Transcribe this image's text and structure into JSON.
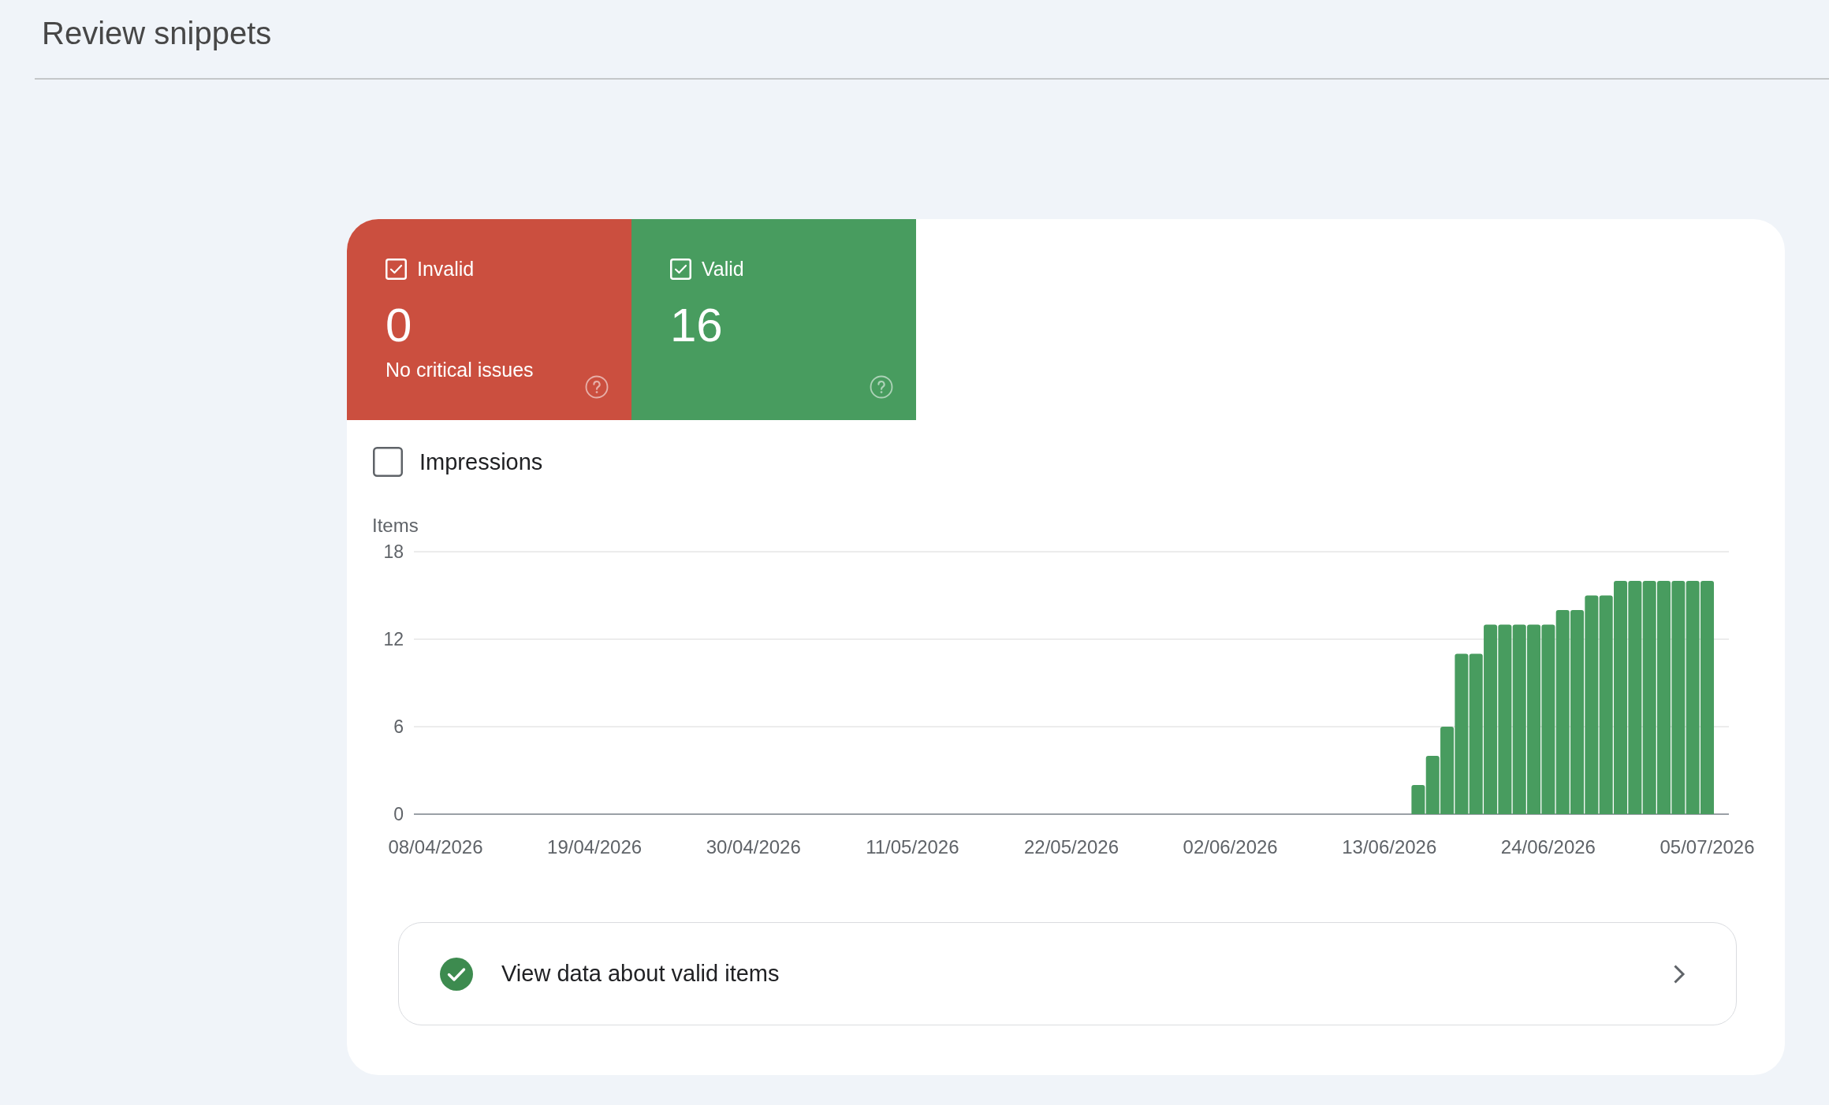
{
  "title": "Review snippets",
  "tiles": [
    {
      "label": "Invalid",
      "checked": true,
      "count": "0",
      "caption": "No critical issues",
      "color": "#cb4f3f"
    },
    {
      "label": "Valid",
      "checked": true,
      "count": "16",
      "color": "#489c5f"
    }
  ],
  "impressions": {
    "label": "Impressions",
    "checked": false
  },
  "chart": {
    "chart_data": {
      "type": "bar",
      "ylabel": "Items",
      "categories": [
        null,
        "08/04/2026",
        null,
        null,
        null,
        null,
        null,
        null,
        null,
        null,
        null,
        null,
        "19/04/2026",
        null,
        null,
        null,
        null,
        null,
        null,
        null,
        null,
        null,
        null,
        "30/04/2026",
        null,
        null,
        null,
        null,
        null,
        null,
        null,
        null,
        null,
        null,
        "11/05/2026",
        null,
        null,
        null,
        null,
        null,
        null,
        null,
        null,
        null,
        null,
        "22/05/2026",
        null,
        null,
        null,
        null,
        null,
        null,
        null,
        null,
        null,
        null,
        "02/06/2026",
        null,
        null,
        null,
        null,
        null,
        null,
        null,
        null,
        null,
        null,
        "13/06/2026",
        null,
        null,
        null,
        null,
        null,
        null,
        null,
        null,
        null,
        null,
        "24/06/2026",
        null,
        null,
        null,
        null,
        null,
        null,
        null,
        null,
        null,
        null,
        "05/07/2026",
        null
      ],
      "values": [
        null,
        null,
        null,
        null,
        null,
        null,
        null,
        null,
        null,
        null,
        null,
        null,
        null,
        null,
        null,
        null,
        null,
        null,
        null,
        null,
        null,
        null,
        null,
        null,
        null,
        null,
        null,
        null,
        null,
        null,
        null,
        null,
        null,
        null,
        null,
        null,
        null,
        null,
        null,
        null,
        null,
        null,
        null,
        null,
        null,
        null,
        null,
        null,
        null,
        null,
        null,
        null,
        null,
        null,
        null,
        null,
        null,
        null,
        null,
        null,
        null,
        null,
        null,
        null,
        null,
        null,
        null,
        null,
        null,
        2,
        4,
        6,
        11,
        11,
        13,
        13,
        13,
        13,
        13,
        14,
        14,
        15,
        15,
        16,
        16,
        16,
        16,
        16,
        16,
        16,
        null
      ],
      "ylim": [
        0,
        18
      ],
      "yticks": [
        0,
        6,
        12,
        18
      ]
    }
  },
  "details_link": {
    "label": "View data about valid items"
  }
}
